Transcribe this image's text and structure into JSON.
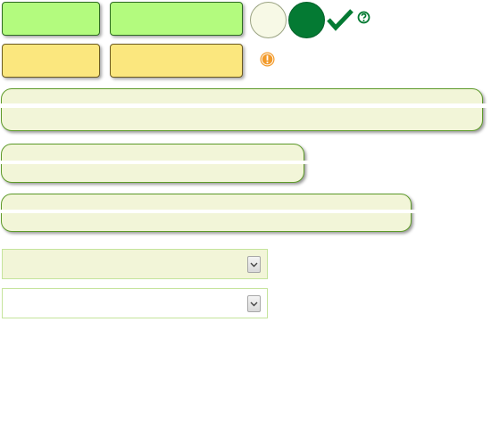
{
  "buttons": {
    "green": [
      "",
      ""
    ],
    "yellow": [
      "",
      ""
    ]
  },
  "status": {
    "valid_icon": "check-icon",
    "help_icon": "question-icon",
    "warning_icon": "exclamation-icon"
  },
  "inputs": {
    "pill_fields": [
      "",
      "",
      ""
    ],
    "selects": [
      {
        "value": ""
      },
      {
        "value": ""
      }
    ]
  },
  "colors": {
    "green_button": "#b3fb7e",
    "yellow_button": "#fbe77e",
    "accent_green": "#047a33",
    "warning_orange": "#f29a2a",
    "field_fill": "#f2f5d8"
  }
}
